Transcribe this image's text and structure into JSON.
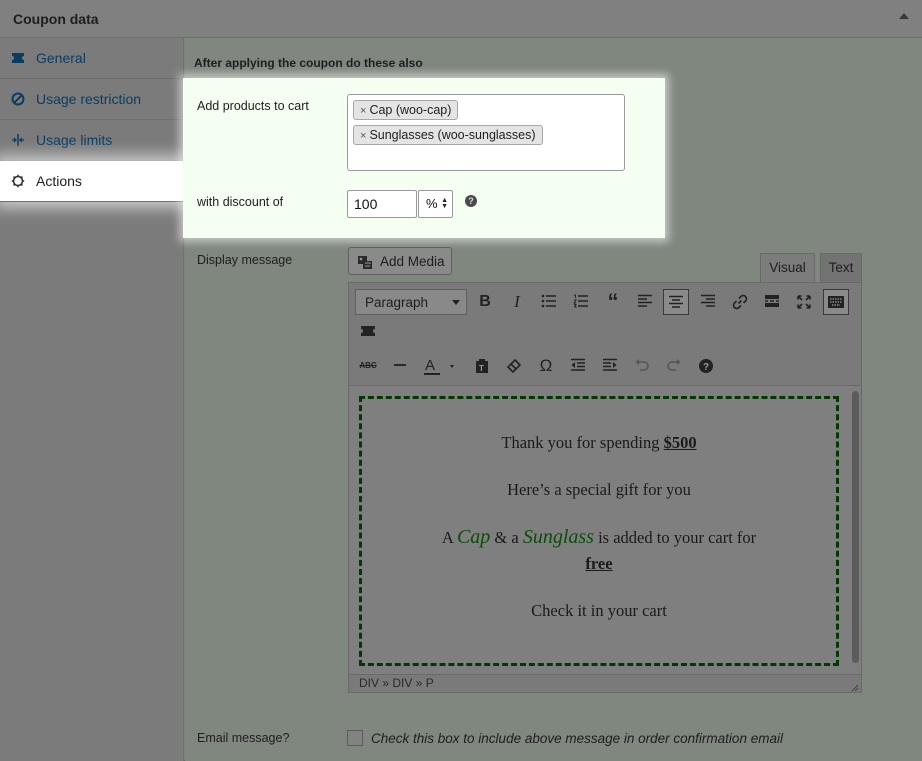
{
  "panel": {
    "title": "Coupon data"
  },
  "tabs": [
    {
      "label": "General",
      "icon": "ticket-icon"
    },
    {
      "label": "Usage restriction",
      "icon": "restricted-icon"
    },
    {
      "label": "Usage limits",
      "icon": "limits-icon"
    },
    {
      "label": "Actions",
      "icon": "gear-icon",
      "active": true
    }
  ],
  "actions": {
    "heading": "After applying the coupon do these also",
    "add_products_label": "Add products to cart",
    "products": [
      "Cap (woo-cap)",
      "Sunglasses (woo-sunglasses)"
    ],
    "chip_remove": "×",
    "discount_label": "with discount of",
    "discount_value": "100",
    "discount_unit": "%",
    "help": "?"
  },
  "editor": {
    "label": "Display message",
    "add_media": "Add Media",
    "tab_visual": "Visual",
    "tab_text": "Text",
    "format_select": "Paragraph",
    "statusbar": "DIV » DIV » P",
    "content": {
      "line1_prefix": "Thank you for spending ",
      "line1_amount": "$500",
      "line2": "Here’s a special gift for you",
      "line3_a": "A ",
      "line3_cap": "Cap",
      "line3_and": " & a ",
      "line3_sunglass": "Sunglass",
      "line3_rest": " is added to your cart for",
      "line4": "free",
      "line5": "Check it in your cart"
    }
  },
  "email": {
    "label": "Email message?",
    "checkbox_text": "Check this box to include above message in order confirmation email"
  }
}
